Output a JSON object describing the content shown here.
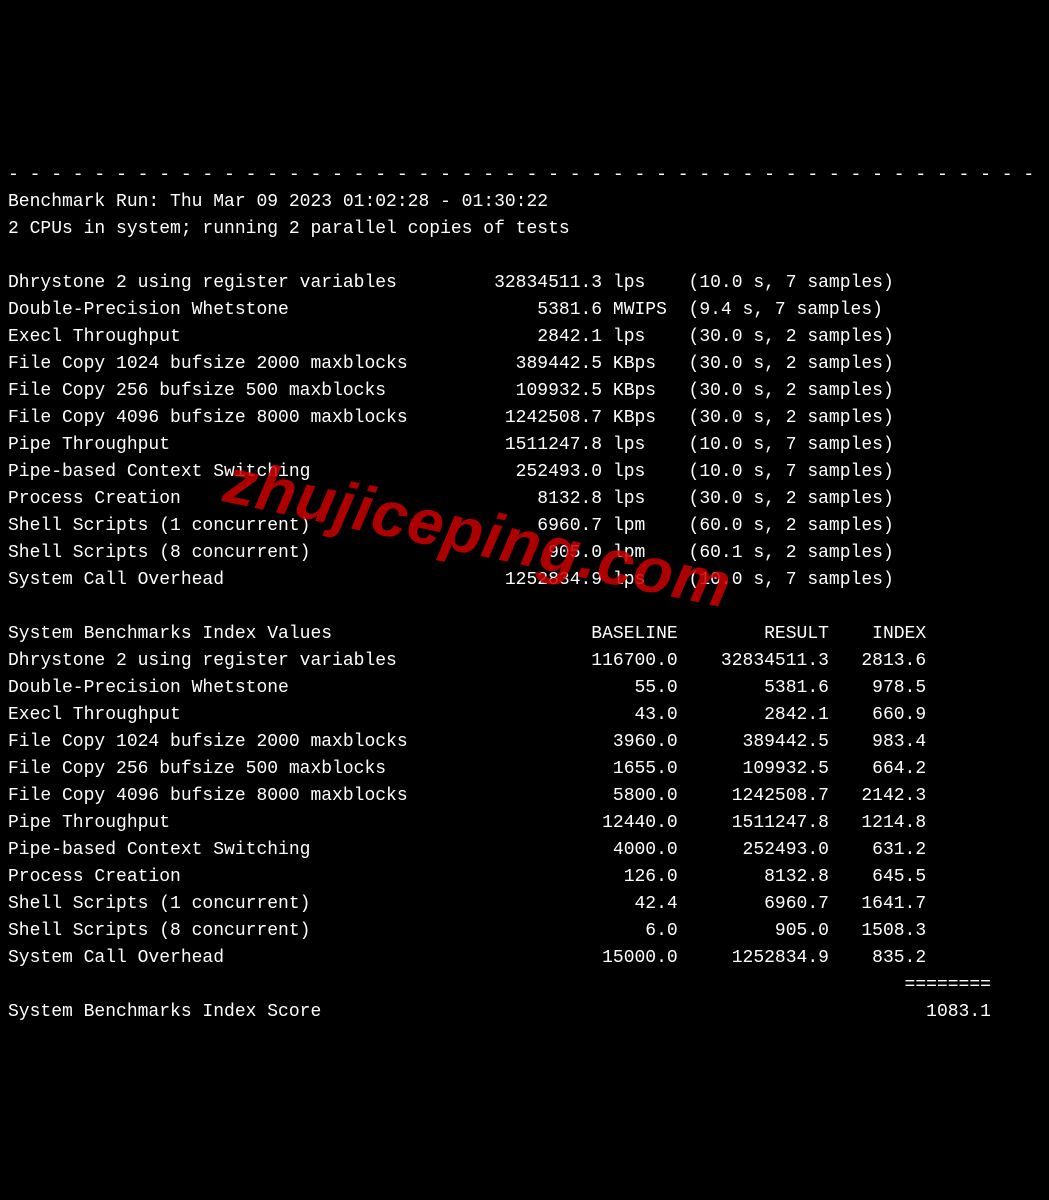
{
  "separator_dashes": "- - - - - - - - - - - - - - - - - - - - - - - - - - - - - - - - - - - - - - - - - - - - - - - -",
  "run_header": "Benchmark Run: Thu Mar 09 2023 01:02:28 - 01:30:22",
  "cpu_line": "2 CPUs in system; running 2 parallel copies of tests",
  "tests": [
    {
      "name": "Dhrystone 2 using register variables",
      "value": "32834511.3",
      "unit": "lps",
      "timing": "(10.0 s, 7 samples)"
    },
    {
      "name": "Double-Precision Whetstone",
      "value": "5381.6",
      "unit": "MWIPS",
      "timing": "(9.4 s, 7 samples)"
    },
    {
      "name": "Execl Throughput",
      "value": "2842.1",
      "unit": "lps",
      "timing": "(30.0 s, 2 samples)"
    },
    {
      "name": "File Copy 1024 bufsize 2000 maxblocks",
      "value": "389442.5",
      "unit": "KBps",
      "timing": "(30.0 s, 2 samples)"
    },
    {
      "name": "File Copy 256 bufsize 500 maxblocks",
      "value": "109932.5",
      "unit": "KBps",
      "timing": "(30.0 s, 2 samples)"
    },
    {
      "name": "File Copy 4096 bufsize 8000 maxblocks",
      "value": "1242508.7",
      "unit": "KBps",
      "timing": "(30.0 s, 2 samples)"
    },
    {
      "name": "Pipe Throughput",
      "value": "1511247.8",
      "unit": "lps",
      "timing": "(10.0 s, 7 samples)"
    },
    {
      "name": "Pipe-based Context Switching",
      "value": "252493.0",
      "unit": "lps",
      "timing": "(10.0 s, 7 samples)"
    },
    {
      "name": "Process Creation",
      "value": "8132.8",
      "unit": "lps",
      "timing": "(30.0 s, 2 samples)"
    },
    {
      "name": "Shell Scripts (1 concurrent)",
      "value": "6960.7",
      "unit": "lpm",
      "timing": "(60.0 s, 2 samples)"
    },
    {
      "name": "Shell Scripts (8 concurrent)",
      "value": "905.0",
      "unit": "lpm",
      "timing": "(60.1 s, 2 samples)"
    },
    {
      "name": "System Call Overhead",
      "value": "1252834.9",
      "unit": "lps",
      "timing": "(10.0 s, 7 samples)"
    }
  ],
  "index_header": {
    "title": "System Benchmarks Index Values",
    "col_baseline": "BASELINE",
    "col_result": "RESULT",
    "col_index": "INDEX"
  },
  "index_rows": [
    {
      "name": "Dhrystone 2 using register variables",
      "baseline": "116700.0",
      "result": "32834511.3",
      "index": "2813.6"
    },
    {
      "name": "Double-Precision Whetstone",
      "baseline": "55.0",
      "result": "5381.6",
      "index": "978.5"
    },
    {
      "name": "Execl Throughput",
      "baseline": "43.0",
      "result": "2842.1",
      "index": "660.9"
    },
    {
      "name": "File Copy 1024 bufsize 2000 maxblocks",
      "baseline": "3960.0",
      "result": "389442.5",
      "index": "983.4"
    },
    {
      "name": "File Copy 256 bufsize 500 maxblocks",
      "baseline": "1655.0",
      "result": "109932.5",
      "index": "664.2"
    },
    {
      "name": "File Copy 4096 bufsize 8000 maxblocks",
      "baseline": "5800.0",
      "result": "1242508.7",
      "index": "2142.3"
    },
    {
      "name": "Pipe Throughput",
      "baseline": "12440.0",
      "result": "1511247.8",
      "index": "1214.8"
    },
    {
      "name": "Pipe-based Context Switching",
      "baseline": "4000.0",
      "result": "252493.0",
      "index": "631.2"
    },
    {
      "name": "Process Creation",
      "baseline": "126.0",
      "result": "8132.8",
      "index": "645.5"
    },
    {
      "name": "Shell Scripts (1 concurrent)",
      "baseline": "42.4",
      "result": "6960.7",
      "index": "1641.7"
    },
    {
      "name": "Shell Scripts (8 concurrent)",
      "baseline": "6.0",
      "result": "905.0",
      "index": "1508.3"
    },
    {
      "name": "System Call Overhead",
      "baseline": "15000.0",
      "result": "1252834.9",
      "index": "835.2"
    }
  ],
  "score_separator": "                                                                                   ========",
  "score_label": "System Benchmarks Index Score",
  "score_value": "1083.1",
  "watermark": "zhujiceping.com"
}
